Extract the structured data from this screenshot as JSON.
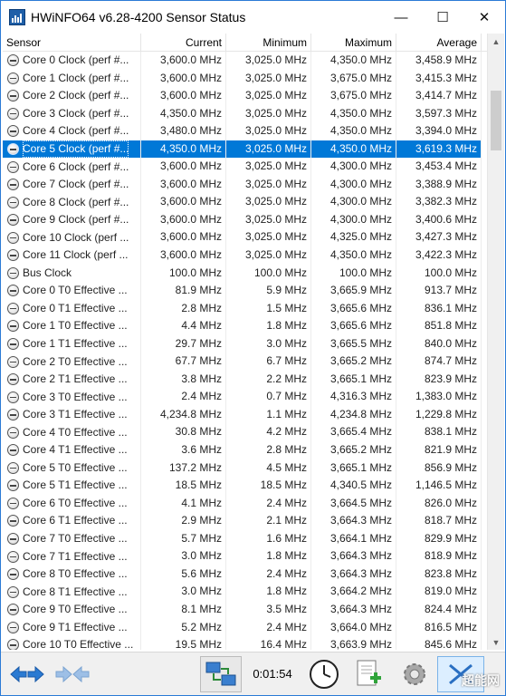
{
  "window": {
    "title": "HWiNFO64 v6.28-4200 Sensor Status"
  },
  "controls": {
    "minimize": "—",
    "maximize": "☐",
    "close": "✕"
  },
  "columns": {
    "sensor": "Sensor",
    "current": "Current",
    "minimum": "Minimum",
    "maximum": "Maximum",
    "average": "Average"
  },
  "rows": [
    {
      "name": "Core 0 Clock (perf #...",
      "current": "3,600.0 MHz",
      "minimum": "3,025.0 MHz",
      "maximum": "4,350.0 MHz",
      "average": "3,458.9 MHz"
    },
    {
      "name": "Core 1 Clock (perf #...",
      "current": "3,600.0 MHz",
      "minimum": "3,025.0 MHz",
      "maximum": "3,675.0 MHz",
      "average": "3,415.3 MHz"
    },
    {
      "name": "Core 2 Clock (perf #...",
      "current": "3,600.0 MHz",
      "minimum": "3,025.0 MHz",
      "maximum": "3,675.0 MHz",
      "average": "3,414.7 MHz"
    },
    {
      "name": "Core 3 Clock (perf #...",
      "current": "4,350.0 MHz",
      "minimum": "3,025.0 MHz",
      "maximum": "4,350.0 MHz",
      "average": "3,597.3 MHz"
    },
    {
      "name": "Core 4 Clock (perf #...",
      "current": "3,480.0 MHz",
      "minimum": "3,025.0 MHz",
      "maximum": "4,350.0 MHz",
      "average": "3,394.0 MHz"
    },
    {
      "name": "Core 5 Clock (perf #...",
      "current": "4,350.0 MHz",
      "minimum": "3,025.0 MHz",
      "maximum": "4,350.0 MHz",
      "average": "3,619.3 MHz",
      "selected": true
    },
    {
      "name": "Core 6 Clock (perf #...",
      "current": "3,600.0 MHz",
      "minimum": "3,025.0 MHz",
      "maximum": "4,300.0 MHz",
      "average": "3,453.4 MHz"
    },
    {
      "name": "Core 7 Clock (perf #...",
      "current": "3,600.0 MHz",
      "minimum": "3,025.0 MHz",
      "maximum": "4,300.0 MHz",
      "average": "3,388.9 MHz"
    },
    {
      "name": "Core 8 Clock (perf #...",
      "current": "3,600.0 MHz",
      "minimum": "3,025.0 MHz",
      "maximum": "4,300.0 MHz",
      "average": "3,382.3 MHz"
    },
    {
      "name": "Core 9 Clock (perf #...",
      "current": "3,600.0 MHz",
      "minimum": "3,025.0 MHz",
      "maximum": "4,300.0 MHz",
      "average": "3,400.6 MHz"
    },
    {
      "name": "Core 10 Clock (perf ...",
      "current": "3,600.0 MHz",
      "minimum": "3,025.0 MHz",
      "maximum": "4,325.0 MHz",
      "average": "3,427.3 MHz"
    },
    {
      "name": "Core 11 Clock (perf ...",
      "current": "3,600.0 MHz",
      "minimum": "3,025.0 MHz",
      "maximum": "4,350.0 MHz",
      "average": "3,422.3 MHz"
    },
    {
      "name": "Bus Clock",
      "current": "100.0 MHz",
      "minimum": "100.0 MHz",
      "maximum": "100.0 MHz",
      "average": "100.0 MHz"
    },
    {
      "name": "Core 0 T0 Effective ...",
      "current": "81.9 MHz",
      "minimum": "5.9 MHz",
      "maximum": "3,665.9 MHz",
      "average": "913.7 MHz"
    },
    {
      "name": "Core 0 T1 Effective ...",
      "current": "2.8 MHz",
      "minimum": "1.5 MHz",
      "maximum": "3,665.6 MHz",
      "average": "836.1 MHz"
    },
    {
      "name": "Core 1 T0 Effective ...",
      "current": "4.4 MHz",
      "minimum": "1.8 MHz",
      "maximum": "3,665.6 MHz",
      "average": "851.8 MHz"
    },
    {
      "name": "Core 1 T1 Effective ...",
      "current": "29.7 MHz",
      "minimum": "3.0 MHz",
      "maximum": "3,665.5 MHz",
      "average": "840.0 MHz"
    },
    {
      "name": "Core 2 T0 Effective ...",
      "current": "67.7 MHz",
      "minimum": "6.7 MHz",
      "maximum": "3,665.2 MHz",
      "average": "874.7 MHz"
    },
    {
      "name": "Core 2 T1 Effective ...",
      "current": "3.8 MHz",
      "minimum": "2.2 MHz",
      "maximum": "3,665.1 MHz",
      "average": "823.9 MHz"
    },
    {
      "name": "Core 3 T0 Effective ...",
      "current": "2.4 MHz",
      "minimum": "0.7 MHz",
      "maximum": "4,316.3 MHz",
      "average": "1,383.0 MHz"
    },
    {
      "name": "Core 3 T1 Effective ...",
      "current": "4,234.8 MHz",
      "minimum": "1.1 MHz",
      "maximum": "4,234.8 MHz",
      "average": "1,229.8 MHz"
    },
    {
      "name": "Core 4 T0 Effective ...",
      "current": "30.8 MHz",
      "minimum": "4.2 MHz",
      "maximum": "3,665.4 MHz",
      "average": "838.1 MHz"
    },
    {
      "name": "Core 4 T1 Effective ...",
      "current": "3.6 MHz",
      "minimum": "2.8 MHz",
      "maximum": "3,665.2 MHz",
      "average": "821.9 MHz"
    },
    {
      "name": "Core 5 T0 Effective ...",
      "current": "137.2 MHz",
      "minimum": "4.5 MHz",
      "maximum": "3,665.1 MHz",
      "average": "856.9 MHz"
    },
    {
      "name": "Core 5 T1 Effective ...",
      "current": "18.5 MHz",
      "minimum": "18.5 MHz",
      "maximum": "4,340.5 MHz",
      "average": "1,146.5 MHz"
    },
    {
      "name": "Core 6 T0 Effective ...",
      "current": "4.1 MHz",
      "minimum": "2.4 MHz",
      "maximum": "3,664.5 MHz",
      "average": "826.0 MHz"
    },
    {
      "name": "Core 6 T1 Effective ...",
      "current": "2.9 MHz",
      "minimum": "2.1 MHz",
      "maximum": "3,664.3 MHz",
      "average": "818.7 MHz"
    },
    {
      "name": "Core 7 T0 Effective ...",
      "current": "5.7 MHz",
      "minimum": "1.6 MHz",
      "maximum": "3,664.1 MHz",
      "average": "829.9 MHz"
    },
    {
      "name": "Core 7 T1 Effective ...",
      "current": "3.0 MHz",
      "minimum": "1.8 MHz",
      "maximum": "3,664.3 MHz",
      "average": "818.9 MHz"
    },
    {
      "name": "Core 8 T0 Effective ...",
      "current": "5.6 MHz",
      "minimum": "2.4 MHz",
      "maximum": "3,664.3 MHz",
      "average": "823.8 MHz"
    },
    {
      "name": "Core 8 T1 Effective ...",
      "current": "3.0 MHz",
      "minimum": "1.8 MHz",
      "maximum": "3,664.2 MHz",
      "average": "819.0 MHz"
    },
    {
      "name": "Core 9 T0 Effective ...",
      "current": "8.1 MHz",
      "minimum": "3.5 MHz",
      "maximum": "3,664.3 MHz",
      "average": "824.4 MHz"
    },
    {
      "name": "Core 9 T1 Effective ...",
      "current": "5.2 MHz",
      "minimum": "2.4 MHz",
      "maximum": "3,664.0 MHz",
      "average": "816.5 MHz"
    },
    {
      "name": "Core 10 T0 Effective ...",
      "current": "19.5 MHz",
      "minimum": "16.4 MHz",
      "maximum": "3,663.9 MHz",
      "average": "845.6 MHz"
    }
  ],
  "toolbar": {
    "timer": "0:01:54",
    "watermark": "超能网"
  },
  "colors": {
    "selection": "#0078d7",
    "window_border": "#2b7bd6"
  }
}
